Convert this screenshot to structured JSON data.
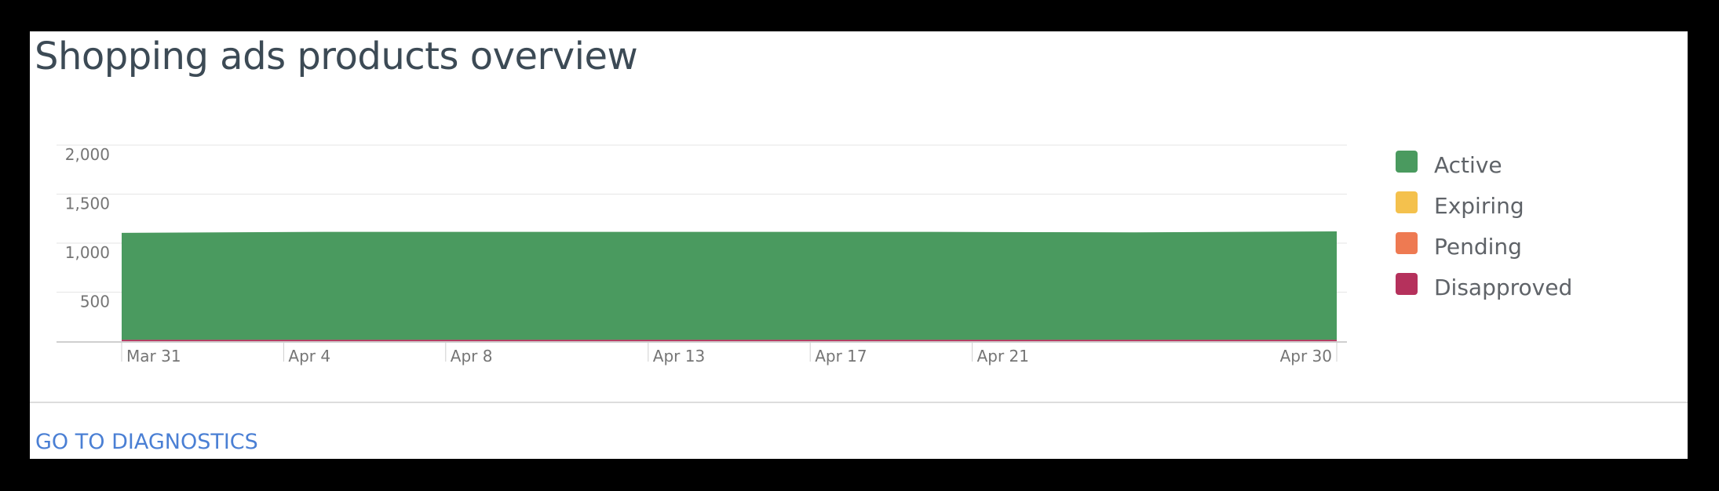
{
  "card": {
    "title": "Shopping ads products overview",
    "diagnostics_link": "GO TO DIAGNOSTICS"
  },
  "legend": [
    {
      "label": "Active",
      "color": "#4a9a5f"
    },
    {
      "label": "Expiring",
      "color": "#f4c14d"
    },
    {
      "label": "Pending",
      "color": "#ee7a52"
    },
    {
      "label": "Disapproved",
      "color": "#b5315c"
    }
  ],
  "chart_data": {
    "type": "area",
    "stacked": true,
    "x": [
      "Mar 31",
      "Apr 4",
      "Apr 8",
      "Apr 13",
      "Apr 17",
      "Apr 21",
      "Apr 30"
    ],
    "x_tick_labels": [
      "Mar 31",
      "Apr 4",
      "Apr 8",
      "Apr 13",
      "Apr 17",
      "Apr 21",
      "Apr 30"
    ],
    "y_ticks": [
      500,
      1000,
      1500,
      2000
    ],
    "y_tick_labels": [
      "500",
      "1,000",
      "1,500",
      "2,000"
    ],
    "ylim": [
      0,
      2000
    ],
    "grid": true,
    "legend_position": "right",
    "series": [
      {
        "name": "Active",
        "color": "#4a9a5f",
        "values": [
          1090,
          1100,
          1100,
          1100,
          1100,
          1095,
          1105
        ]
      },
      {
        "name": "Expiring",
        "color": "#f4c14d",
        "values": [
          0,
          0,
          0,
          0,
          0,
          0,
          0
        ]
      },
      {
        "name": "Pending",
        "color": "#ee7a52",
        "values": [
          0,
          0,
          0,
          0,
          0,
          0,
          0
        ]
      },
      {
        "name": "Disapproved",
        "color": "#b5315c",
        "values": [
          15,
          15,
          15,
          15,
          15,
          15,
          15
        ]
      }
    ]
  }
}
